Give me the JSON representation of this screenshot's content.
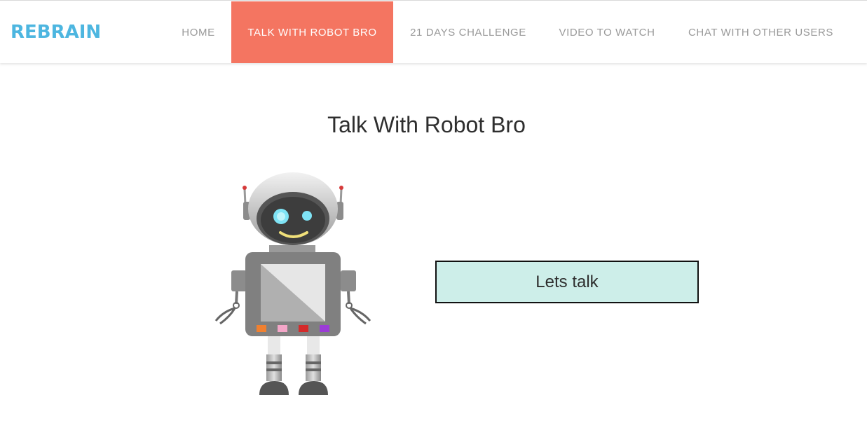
{
  "brand": {
    "name": "REBRAIN"
  },
  "nav": {
    "home": "HOME",
    "talk_with_robot_bro": "TALK WITH ROBOT BRO",
    "days_challenge": "21 DAYS CHALLENGE",
    "video_to_watch": "VIDEO TO WATCH",
    "chat_with_other_users": "CHAT WITH OTHER USERS",
    "active": "talk_with_robot_bro"
  },
  "main": {
    "title": "Talk With Robot Bro",
    "talk_button_label": "Lets talk",
    "robot_icon": "robot-illustration"
  },
  "colors": {
    "brand": "#4db6e0",
    "active_nav": "#f47561",
    "nav_text": "#999999",
    "button_bg": "#cdeee9"
  }
}
